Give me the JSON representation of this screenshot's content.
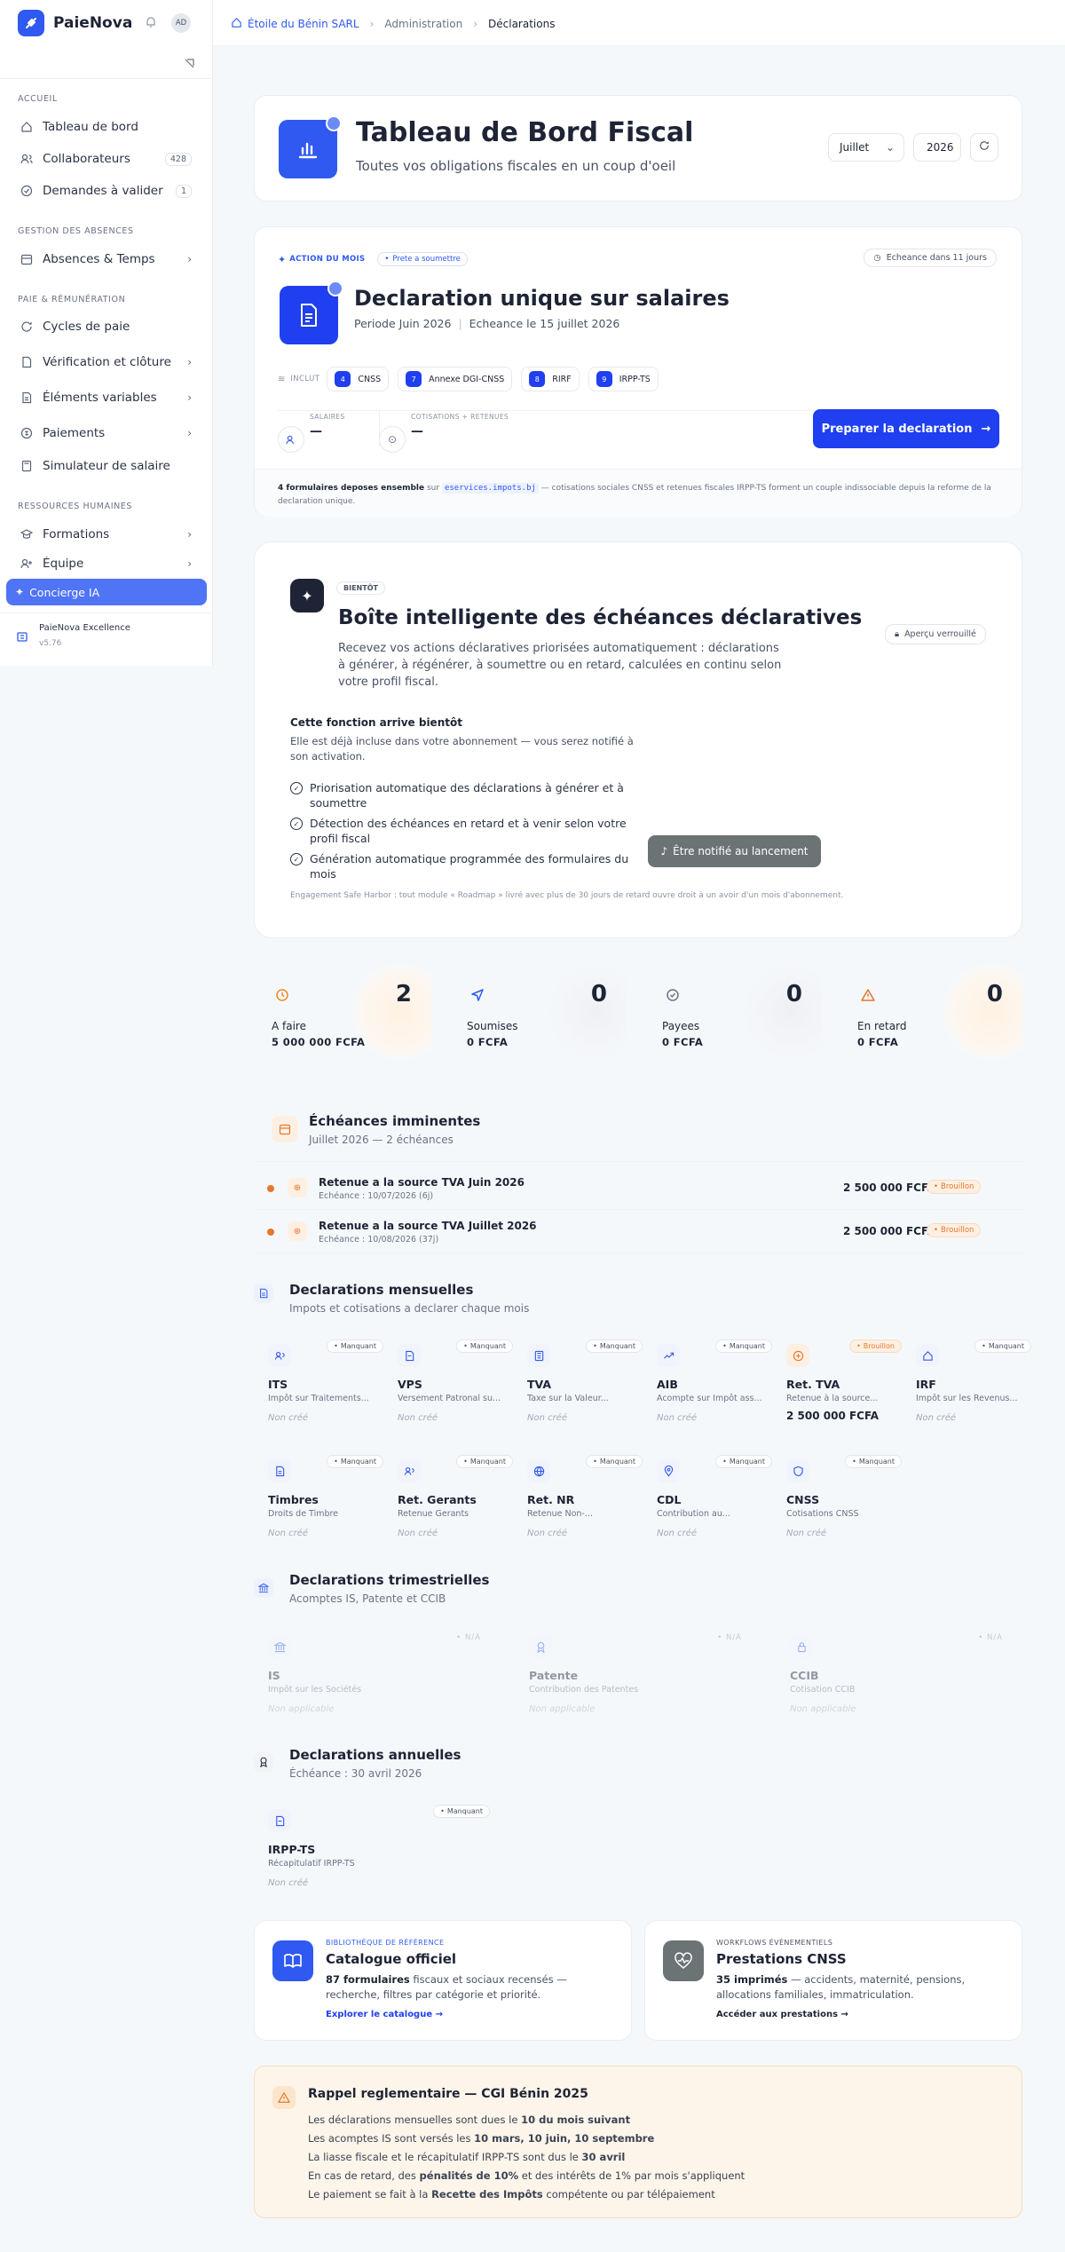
{
  "app": {
    "name": "PaieNova",
    "avatar": "AD"
  },
  "sidebar": {
    "sections": [
      {
        "title": "ACCUEIL"
      },
      {
        "title": "GESTION DES ABSENCES"
      },
      {
        "title": "PAIE & RÉMUNÉRATION"
      },
      {
        "title": "RESSOURCES HUMAINES"
      }
    ],
    "items": [
      {
        "label": "Tableau de bord"
      },
      {
        "label": "Collaborateurs",
        "count": "428"
      },
      {
        "label": "Demandes à valider",
        "count": "1"
      },
      {
        "label": "Absences & Temps"
      },
      {
        "label": "Cycles de paie"
      },
      {
        "label": "Vérification et clôture"
      },
      {
        "label": "Éléments variables"
      },
      {
        "label": "Paiements"
      },
      {
        "label": "Simulateur de salaire"
      },
      {
        "label": "Formations"
      },
      {
        "label": "Équipe"
      }
    ],
    "concierge": "Concierge IA",
    "plan": {
      "name": "PaieNova Excellence",
      "version": "v5.76"
    }
  },
  "breadcrumb": [
    "Étoile du Bénin SARL",
    "Administration",
    "Déclarations"
  ],
  "hero": {
    "title": "Tableau de Bord Fiscal",
    "subtitle": "Toutes vos obligations fiscales en un coup d'oeil",
    "month": "Juillet",
    "year": "2026"
  },
  "action": {
    "badge": "ACTION DU MOIS",
    "status": "Prete a soumettre",
    "due": "Echeance dans 11 jours",
    "title": "Declaration unique sur salaires",
    "period": "Periode Juin 2026",
    "deadline": "Echeance le 15 juillet 2026",
    "include_label": "INCLUT",
    "includes": [
      {
        "n": "4",
        "label": "CNSS"
      },
      {
        "n": "7",
        "label": "Annexe DGI-CNSS"
      },
      {
        "n": "8",
        "label": "RIRF"
      },
      {
        "n": "9",
        "label": "IRPP-TS"
      }
    ],
    "salaries_label": "SALAIRES",
    "salaries_value": "—",
    "cot_label": "COTISATIONS + RETENUES",
    "cot_value": "—",
    "cta": "Preparer la declaration",
    "footer_a": "4 formulaires deposes ensemble",
    "footer_b": "sur",
    "footer_link": "eservices.impots.bj",
    "footer_c": "— cotisations sociales CNSS et retenues fiscales IRPP-TS forment un couple indissociable depuis la reforme de la declaration unique."
  },
  "smart": {
    "badge": "BIENTÔT",
    "title": "Boîte intelligente des échéances déclaratives",
    "desc": "Recevez vos actions déclaratives priorisées automatiquement : déclarations à générer, à régénérer, à soumettre ou en retard, calculées en continu selon votre profil fiscal.",
    "locked": "Aperçu verrouillé",
    "soon_title": "Cette fonction arrive bientôt",
    "soon_desc": "Elle est déjà incluse dans votre abonnement — vous serez notifié à son activation.",
    "features": [
      "Priorisation automatique des déclarations à générer et à soumettre",
      "Détection des échéances en retard et à venir selon votre profil fiscal",
      "Génération automatique programmée des formulaires du mois"
    ],
    "notify": "Être notifié au lancement",
    "footnote": "Engagement Safe Harbor : tout module « Roadmap » livré avec plus de 30 jours de retard ouvre droit à un avoir d'un mois d'abonnement."
  },
  "kpis": [
    {
      "label": "A faire",
      "value": "2",
      "amount": "5 000 000 FCFA",
      "color": "#f08a24"
    },
    {
      "label": "Soumises",
      "value": "0",
      "amount": "0 FCFA",
      "color": "#2f59f0"
    },
    {
      "label": "Payees",
      "value": "0",
      "amount": "0 FCFA",
      "color": "#6b7385"
    },
    {
      "label": "En retard",
      "value": "0",
      "amount": "0 FCFA",
      "color": "#e6762a"
    }
  ],
  "upcoming": {
    "title": "Échéances imminentes",
    "subtitle": "Juillet 2026 — 2 échéances",
    "items": [
      {
        "title": "Retenue a la source TVA Juin 2026",
        "due": "Echéance : 10/07/2026 (6j)",
        "amount": "2 500 000 FCFA",
        "status": "Brouillon"
      },
      {
        "title": "Retenue a la source TVA Juillet 2026",
        "due": "Echéance : 10/08/2026 (37j)",
        "amount": "2 500 000 FCFA",
        "status": "Brouillon"
      }
    ]
  },
  "monthly": {
    "title": "Declarations mensuelles",
    "subtitle": "Impots et cotisations a declarer chaque mois",
    "items": [
      {
        "name": "ITS",
        "desc": "Impôt sur Traitements...",
        "status": "Manquant",
        "value": "Non créé"
      },
      {
        "name": "VPS",
        "desc": "Versement Patronal su...",
        "status": "Manquant",
        "value": "Non créé"
      },
      {
        "name": "TVA",
        "desc": "Taxe sur la Valeur...",
        "status": "Manquant",
        "value": "Non créé"
      },
      {
        "name": "AIB",
        "desc": "Acompte sur Impôt ass...",
        "status": "Manquant",
        "value": "Non créé"
      },
      {
        "name": "Ret. TVA",
        "desc": "Retenue à la source...",
        "status": "Brouillon",
        "value": "2 500 000 FCFA"
      },
      {
        "name": "IRF",
        "desc": "Impôt sur les Revenus...",
        "status": "Manquant",
        "value": "Non créé"
      },
      {
        "name": "Timbres",
        "desc": "Droits de Timbre",
        "status": "Manquant",
        "value": "Non créé"
      },
      {
        "name": "Ret. Gerants",
        "desc": "Retenue Gerants",
        "status": "Manquant",
        "value": "Non créé"
      },
      {
        "name": "Ret. NR",
        "desc": "Retenue Non-...",
        "status": "Manquant",
        "value": "Non créé"
      },
      {
        "name": "CDL",
        "desc": "Contribution au...",
        "status": "Manquant",
        "value": "Non créé"
      },
      {
        "name": "CNSS",
        "desc": "Cotisations CNSS",
        "status": "Manquant",
        "value": "Non créé"
      }
    ]
  },
  "quarterly": {
    "title": "Declarations trimestrielles",
    "subtitle": "Acomptes IS, Patente et CCIB",
    "items": [
      {
        "name": "IS",
        "desc": "Impôt sur les Sociétés",
        "status": "N/A",
        "value": "Non applicable"
      },
      {
        "name": "Patente",
        "desc": "Contribution des Patentes",
        "status": "N/A",
        "value": "Non applicable"
      },
      {
        "name": "CCIB",
        "desc": "Cotisation CCIB",
        "status": "N/A",
        "value": "Non applicable"
      }
    ]
  },
  "annual": {
    "title": "Declarations annuelles",
    "subtitle": "Échéance : 30 avril 2026",
    "items": [
      {
        "name": "IRPP-TS",
        "desc": "Récapitulatif IRPP-TS",
        "status": "Manquant",
        "value": "Non créé"
      }
    ]
  },
  "catalog": {
    "eyebrow": "BIBLIOTHÈQUE DE RÉFÉRENCE",
    "title": "Catalogue officiel",
    "count": "87 formulaires",
    "desc": "fiscaux et sociaux recensés — recherche, filtres par catégorie et priorité.",
    "link": "Explorer le catalogue"
  },
  "cnss": {
    "eyebrow": "WORKFLOWS ÉVÉNEMENTIELS",
    "title": "Prestations CNSS",
    "count": "35 imprimés",
    "desc": "— accidents, maternité, pensions, allocations familiales, immatriculation.",
    "link": "Accéder aux prestations"
  },
  "reminder": {
    "title": "Rappel reglementaire — CGI Bénin 2025",
    "lines": [
      {
        "a": "Les déclarations mensuelles sont dues le ",
        "b": "10 du mois suivant",
        "c": ""
      },
      {
        "a": "Les acomptes IS sont versés les ",
        "b": "10 mars, 10 juin, 10 septembre",
        "c": ""
      },
      {
        "a": "La liasse fiscale et le récapitulatif IRPP-TS sont dus le ",
        "b": "30 avril",
        "c": ""
      },
      {
        "a": "En cas de retard, des ",
        "b": "pénalités de 10%",
        "c": " et des intérêts de 1% par mois s'appliquent"
      },
      {
        "a": "Le paiement se fait à la ",
        "b": "Recette des Impôts",
        "c": " compétente ou par télépaiement"
      }
    ]
  }
}
